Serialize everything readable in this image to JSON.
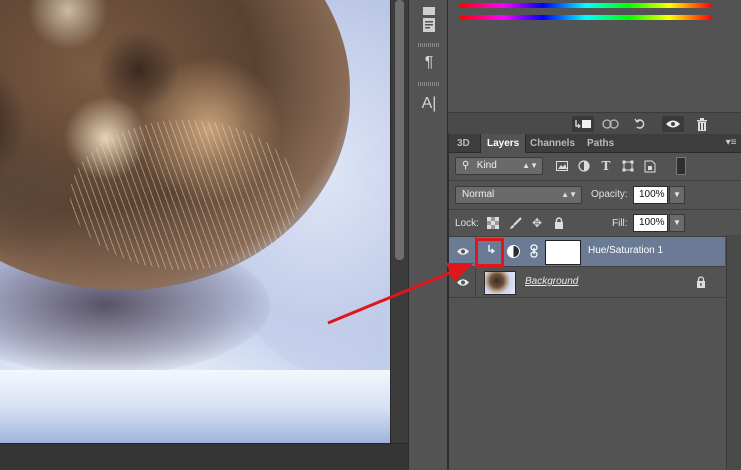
{
  "panels": {
    "tabs": [
      {
        "label": "3D",
        "active": false
      },
      {
        "label": "Layers",
        "active": true
      },
      {
        "label": "Channels",
        "active": false
      },
      {
        "label": "Paths",
        "active": false
      }
    ]
  },
  "filter": {
    "kind_label": "Kind"
  },
  "blend": {
    "mode": "Normal",
    "opacity_label": "Opacity:",
    "opacity_value": "100%"
  },
  "lock": {
    "label": "Lock:",
    "fill_label": "Fill:",
    "fill_value": "100%"
  },
  "layers": [
    {
      "name": "Hue/Saturation 1",
      "selected": true,
      "clipped": true
    },
    {
      "name": "Background",
      "selected": false,
      "locked": true
    }
  ],
  "icons": {
    "eye": "eye-icon",
    "lock": "lock-icon",
    "link": "link-icon",
    "clip": "clip-arrow-icon"
  },
  "colors": {
    "selected_row": "#6b7b95",
    "highlight": "#e0161b",
    "panel_bg": "#535353"
  }
}
